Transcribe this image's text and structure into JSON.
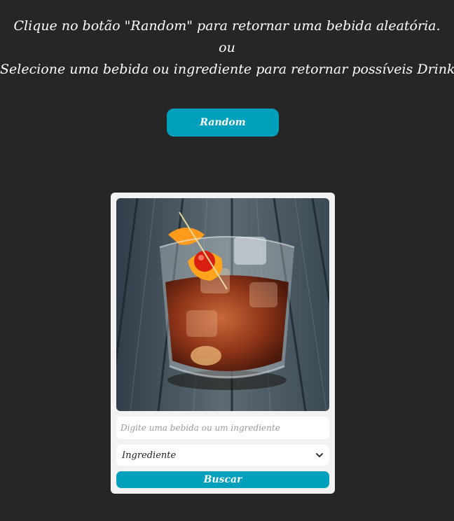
{
  "intro": {
    "line1": "Clique no botão \"Random\" para retornar uma bebida aleatória.",
    "line2": "ou",
    "line3": "Selecione uma bebida ou ingrediente para retornar possíveis Drinks!"
  },
  "random_button": {
    "label": "Random"
  },
  "card": {
    "image_icon": "cocktail-photo",
    "search": {
      "placeholder": "Digite uma bebida ou um ingrediente",
      "value": ""
    },
    "type_select": {
      "selected": "Ingrediente",
      "icon": "chevron-down-icon"
    },
    "search_button": {
      "label": "Buscar"
    }
  },
  "colors": {
    "background": "#262626",
    "accent": "#00a0bd",
    "card": "#f2f2f2",
    "text": "#ffffff"
  }
}
